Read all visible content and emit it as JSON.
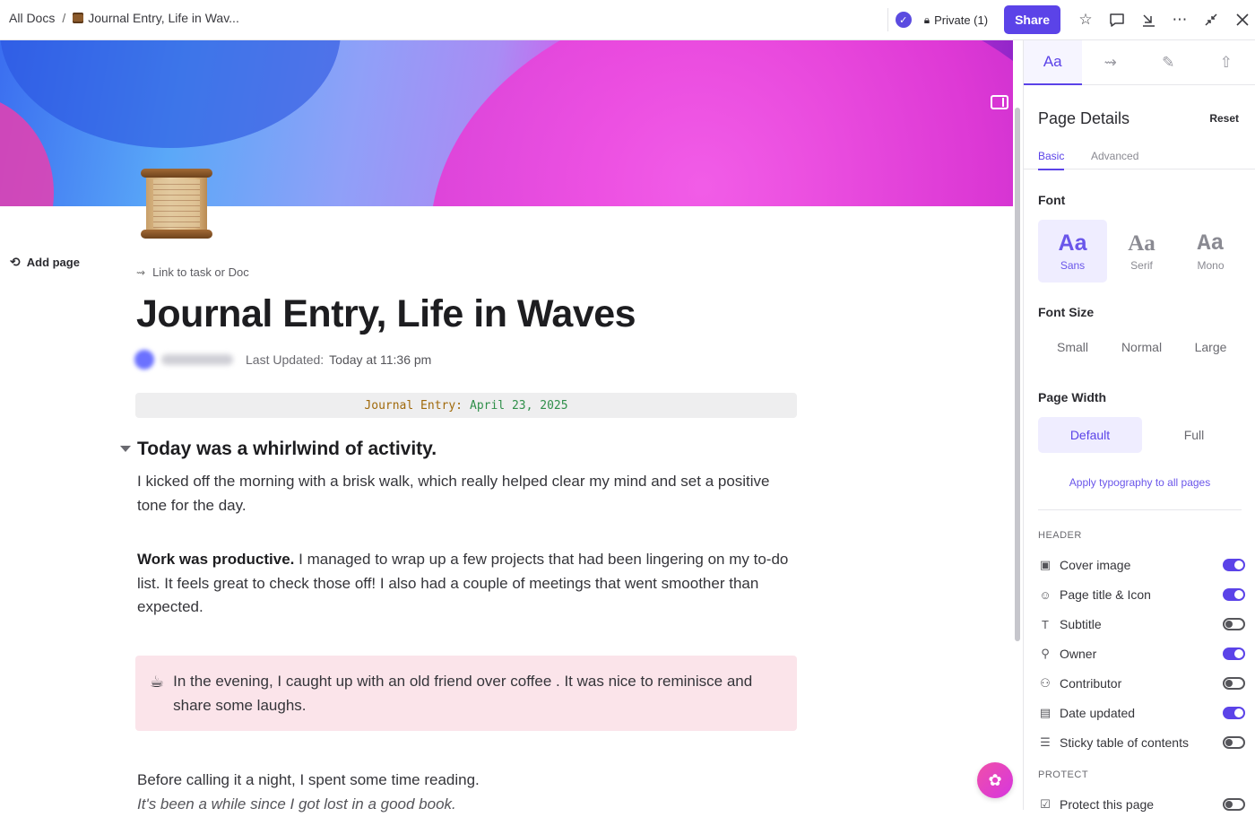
{
  "topbar": {
    "breadcrumb_root": "All Docs",
    "breadcrumb_sep": "/",
    "breadcrumb_doc": "Journal Entry, Life in Wav...",
    "private_label": "Private (1)",
    "share_label": "Share",
    "icons": [
      "check-badge-icon",
      "lock-icon",
      "star-icon",
      "comment-icon",
      "download-icon",
      "more-icon",
      "collapse-icon",
      "close-icon"
    ]
  },
  "sidebar": {
    "add_page_label": "Add page"
  },
  "doc": {
    "link_task_label": "Link to task or Doc",
    "title": "Journal Entry, Life in Waves",
    "last_updated_label": "Last Updated:",
    "last_updated_value": "Today at 11:36 pm",
    "code_key": "Journal Entry:",
    "code_value": "April 23, 2025",
    "heading": "Today was a whirlwind of activity.",
    "para1": "I kicked off the morning with a brisk walk, which really helped clear my mind and set a positive tone for the day.",
    "para2_bold": "Work was productive.",
    "para2_rest": " I managed to wrap up a few projects that had been lingering on my to-do list. It feels great to check those off! I also had a couple of meetings that went smoother than expected.",
    "callout_emoji": "☕",
    "callout_text": "In the evening, I caught up with an old friend over coffee . It was nice to reminisce and share some laughs.",
    "para3": "Before calling it a night, I spent some time reading.",
    "para4": "It's been a while since I got lost in a good book."
  },
  "panel": {
    "tabs": [
      "Aa",
      "⇝",
      "✎",
      "⇧"
    ],
    "title": "Page Details",
    "reset": "Reset",
    "subtabs": [
      "Basic",
      "Advanced"
    ],
    "font_label": "Font",
    "fonts": [
      {
        "glyph": "Aa",
        "name": "Sans"
      },
      {
        "glyph": "Aa",
        "name": "Serif"
      },
      {
        "glyph": "Aa",
        "name": "Mono"
      }
    ],
    "font_size_label": "Font Size",
    "sizes": [
      "Small",
      "Normal",
      "Large"
    ],
    "page_width_label": "Page Width",
    "widths": [
      "Default",
      "Full"
    ],
    "apply_label": "Apply typography to all pages",
    "header_group": "HEADER",
    "header_rows": [
      {
        "label": "Cover image",
        "icon": "image-icon",
        "on": true
      },
      {
        "label": "Page title & Icon",
        "icon": "smile-icon",
        "on": true
      },
      {
        "label": "Subtitle",
        "icon": "text-icon",
        "on": false
      },
      {
        "label": "Owner",
        "icon": "user-icon",
        "on": true
      },
      {
        "label": "Contributor",
        "icon": "users-icon",
        "on": false
      },
      {
        "label": "Date updated",
        "icon": "calendar-icon",
        "on": true
      },
      {
        "label": "Sticky table of contents",
        "icon": "list-icon",
        "on": false
      }
    ],
    "protect_group": "PROTECT",
    "protect_rows": [
      {
        "label": "Protect this page",
        "icon": "shield-check-icon",
        "on": false
      }
    ]
  },
  "colors": {
    "accent": "#5b43e8",
    "callout_bg": "#fbe4ea",
    "code_key": "#a0690b",
    "code_value": "#2f8f4a"
  }
}
